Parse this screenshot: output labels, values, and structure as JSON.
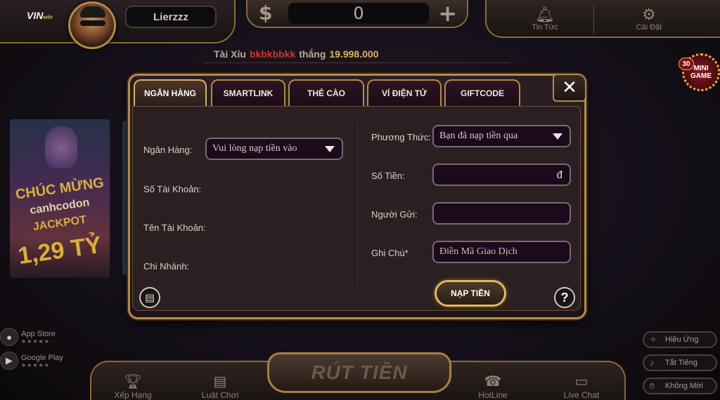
{
  "header": {
    "logo": "VIN",
    "logo_suffix": "win",
    "username": "Lierzzz",
    "balance_symbol": "$",
    "balance": "0",
    "add_symbol": "+",
    "news_label": "Tin Tức",
    "settings_label": "Cài Đặt"
  },
  "ticker": {
    "game": "Tài Xỉu",
    "player": "bkbkbbkk",
    "verb": "thắng",
    "amount": "19.998.000"
  },
  "mini_game": {
    "label": "MINI GAME",
    "badge": "30"
  },
  "poster": {
    "line1": "CHÚC MỪNG",
    "line2": "canhcodon",
    "line3": "JACKPOT",
    "line4": "1,29 TỶ"
  },
  "stores": [
    {
      "label": "App Store",
      "stars": "★★★★★"
    },
    {
      "label": "Google Play",
      "stars": "★★★★★"
    }
  ],
  "side_buttons": [
    {
      "label": "Hiệu Ứng"
    },
    {
      "label": "Tắt Tiếng"
    },
    {
      "label": "Không Mời"
    }
  ],
  "bottom_nav": {
    "rank_label": "Xếp Hạng",
    "rules_label": "Luật Chơi",
    "withdraw_label": "RÚT TIỀN",
    "hotline_label": "HotLine",
    "chat_label": "Live Chat"
  },
  "dialog": {
    "tabs": [
      {
        "label": "NGÂN HÀNG",
        "active": true
      },
      {
        "label": "SMARTLINK",
        "active": false
      },
      {
        "label": "THẺ CÀO",
        "active": false
      },
      {
        "label": "VÍ ĐIỆN TỬ",
        "active": false
      },
      {
        "label": "GIFTCODE",
        "active": false
      }
    ],
    "close_symbol": "✕",
    "left": {
      "bank_label": "Ngân Hàng:",
      "bank_select": "Vui lòng nạp tiền vào",
      "account_no_label": "Số Tài Khoản:",
      "account_name_label": "Tên Tài Khoản:",
      "branch_label": "Chi Nhánh:"
    },
    "right": {
      "method_label": "Phương Thức:",
      "method_select": "Bạn đã nạp tiền qua",
      "amount_label": "Số Tiền:",
      "amount_unit": "đ",
      "sender_label": "Người Gửi:",
      "note_label": "Ghi Chú*",
      "note_placeholder": "Điền Mã Giao Dịch"
    },
    "deposit_button": "NẠP TIỀN",
    "help_symbol": "?"
  },
  "colors": {
    "gold_border": "#b48a48",
    "ticker_highlight": "#d1352b",
    "ticker_amount": "#d8b45c",
    "field_bg": "#1a0a1c"
  }
}
